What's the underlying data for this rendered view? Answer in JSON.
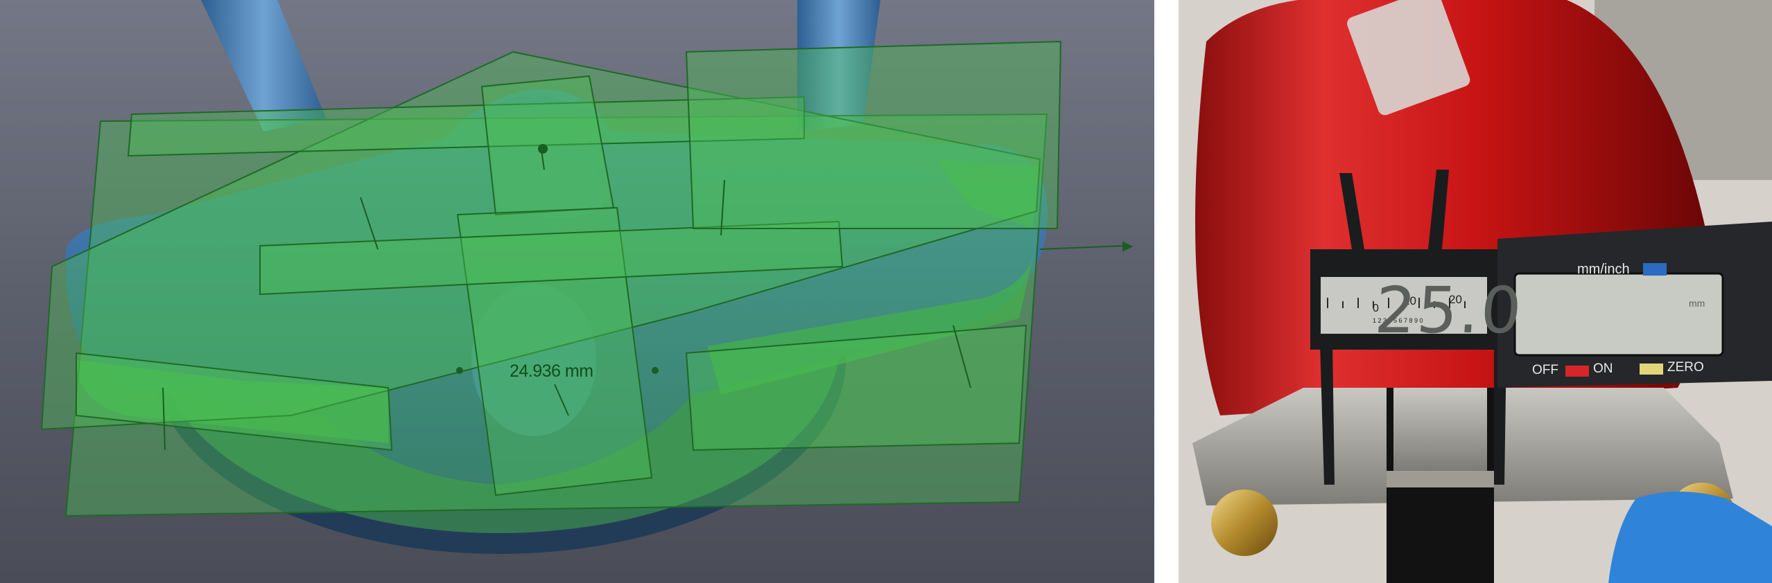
{
  "scan_view": {
    "measurement_label": "24.936 mm"
  },
  "caliper_photo": {
    "display_reading": "25.0",
    "display_unit": "mm",
    "unit_button_label": "mm/inch",
    "off_label": "OFF",
    "on_label": "ON",
    "zero_label": "ZERO",
    "scale_label_10": "10",
    "scale_label_20": "20",
    "scale_label_0": "0",
    "vernier_digits": "1 2 3 4 5 6 7 8 9 0"
  },
  "colors": {
    "scan_background": "#5c5f6c",
    "mesh_blue": "#3f74a8",
    "fit_plane_green": "#3cab46",
    "extinguisher_red": "#d01a1a",
    "caliper_body": "#1b1c1e",
    "lcd_background": "#c8cbc4"
  }
}
